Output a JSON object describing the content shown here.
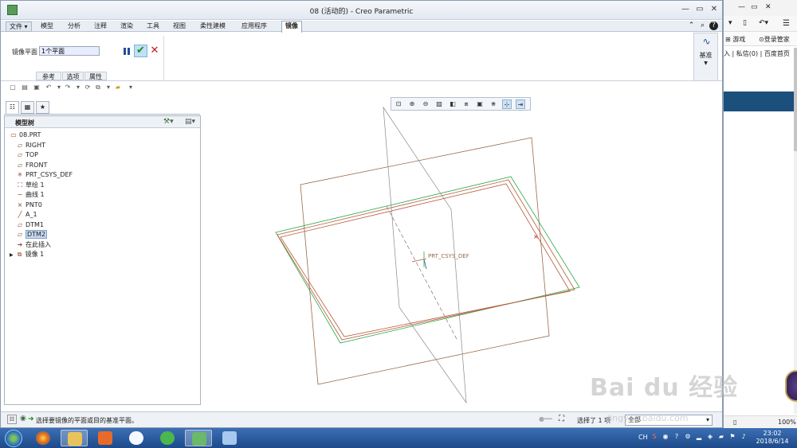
{
  "window": {
    "title": "08 (活动的) - Creo Parametric",
    "controls": {
      "minimize": "—",
      "maximize": "▭",
      "close": "✕"
    },
    "quick_icons": {
      "help": "?",
      "search": "⌕",
      "arrow": "⌃"
    }
  },
  "ribbon": {
    "file_tab": "文件",
    "tabs": [
      "模型",
      "分析",
      "注释",
      "渲染",
      "工具",
      "视图",
      "柔性建模",
      "应用程序"
    ],
    "active_tab": "镜像"
  },
  "mirror_dashboard": {
    "label": "镜像平面",
    "value": "1个平面",
    "subtabs": [
      "参考",
      "选项",
      "属性"
    ],
    "ok_symbol": "✔",
    "cancel_symbol": "✕"
  },
  "datum_group": {
    "label": "基准",
    "icon": "∿"
  },
  "model_tree": {
    "title": "模型树",
    "items": [
      {
        "icon": "▭",
        "label": "08.PRT",
        "level": 0
      },
      {
        "icon": "▱",
        "label": "RIGHT",
        "level": 1
      },
      {
        "icon": "▱",
        "label": "TOP",
        "level": 1
      },
      {
        "icon": "▱",
        "label": "FRONT",
        "level": 1
      },
      {
        "icon": "✳",
        "label": "PRT_CSYS_DEF",
        "level": 1
      },
      {
        "icon": "⛶",
        "label": "草绘 1",
        "level": 1
      },
      {
        "icon": "∼",
        "label": "曲线 1",
        "level": 1
      },
      {
        "icon": "×",
        "label": "PNT0",
        "level": 1
      },
      {
        "icon": "╱",
        "label": "A_1",
        "level": 1
      },
      {
        "icon": "▱",
        "label": "DTM1",
        "level": 1
      },
      {
        "icon": "▱",
        "label": "DTM2",
        "level": 1,
        "selected": true
      },
      {
        "icon": "➔",
        "label": "在此插入",
        "level": 1
      },
      {
        "icon": "⧉",
        "label": "镜像 1",
        "level": 0,
        "expander": "▶"
      }
    ]
  },
  "viewport": {
    "csys_label": "PRT_CSYS_DEF"
  },
  "view_toolbar": {
    "icons": [
      "zoom-fit",
      "zoom-in",
      "zoom-out",
      "repaint",
      "orient",
      "saved-views",
      "display-style",
      "datum-display",
      "spin-center",
      "annotation"
    ]
  },
  "status": {
    "message": "选择要镜像的平面或目的基准平面。",
    "selected": "选择了 1 项",
    "filter": "全部"
  },
  "browser": {
    "games": "游戏",
    "login": "登录管家",
    "links": "入 | 私信(0) | 百度首页",
    "zoom": "100%"
  },
  "taskbar": {
    "lang": "CH",
    "time": "23:02",
    "date": "2018/6/14"
  },
  "watermark": {
    "text": "Bai du 经验",
    "url": "jingyan.baidu.com"
  }
}
